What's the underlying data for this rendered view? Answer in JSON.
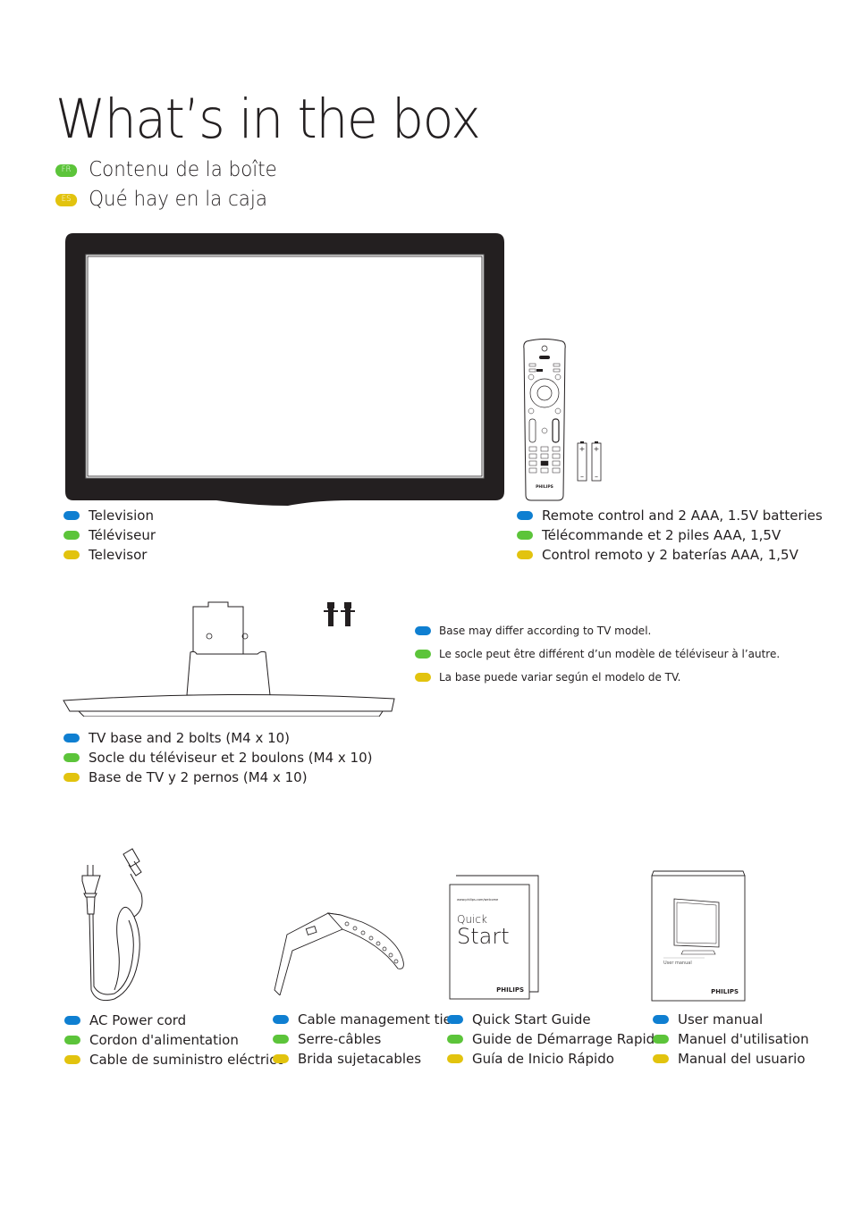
{
  "page": {
    "title": "What’s in the box",
    "subtitles": [
      {
        "lang": "FR",
        "text": "Contenu de la boîte"
      },
      {
        "lang": "ES",
        "text": "Qué hay en la caja"
      }
    ]
  },
  "colors": {
    "en": "#0f7fd1",
    "fr": "#5cc43a",
    "es": "#e2c30e",
    "ink": "#231f20"
  },
  "items": {
    "television": {
      "en": "Television",
      "fr": "Téléviseur",
      "es": "Televisor"
    },
    "remote": {
      "en": "Remote control and 2 AAA, 1.5V batteries",
      "fr": "Télécommande et 2 piles AAA, 1,5V",
      "es": "Control remoto y 2 baterías AAA, 1,5V",
      "brand": "PHILIPS",
      "battery_label": "AAA"
    },
    "base": {
      "en": "TV base and 2 bolts (M4 x 10)",
      "fr": "Socle du téléviseur et 2 boulons (M4 x 10)",
      "es": "Base de TV y 2 pernos (M4 x 10)"
    },
    "base_note": {
      "en": "Base may differ according to TV model.",
      "fr": "Le socle peut être différent d’un modèle de téléviseur à l’autre.",
      "es": "La base puede variar según el modelo de TV."
    },
    "power_cord": {
      "en": "AC Power cord",
      "fr": "Cordon d'alimentation",
      "es": "Cable de suministro eléctrico"
    },
    "cable_tie": {
      "en": "Cable management tie",
      "fr": "Serre-câbles",
      "es": "Brida sujetacables"
    },
    "quick_start": {
      "en": "Quick Start Guide",
      "fr": "Guide de Démarrage Rapide",
      "es": "Guía de Inicio Rápido",
      "cover_line1": "Quick",
      "cover_line2": "Start",
      "cover_url": "www.philips.com/welcome",
      "brand": "PHILIPS"
    },
    "user_manual": {
      "en": "User manual",
      "fr": "Manuel d'utilisation",
      "es": "Manual del usuario",
      "cover_label": "User manual",
      "brand": "PHILIPS"
    }
  }
}
